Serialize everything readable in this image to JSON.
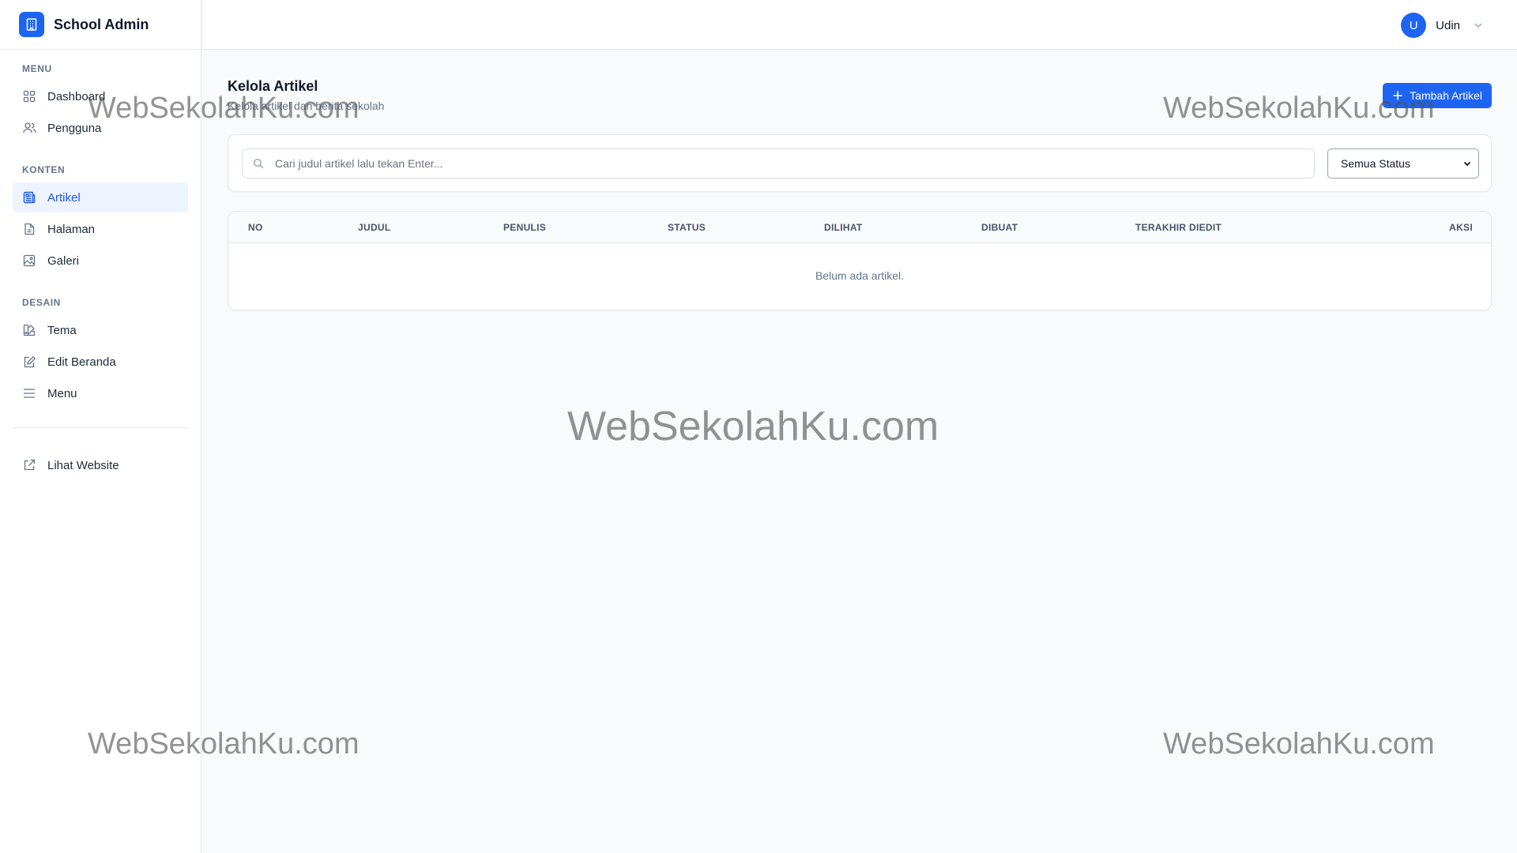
{
  "brand": {
    "name": "School Admin"
  },
  "sidebar": {
    "sections": [
      {
        "label": "MENU",
        "items": [
          {
            "label": "Dashboard",
            "icon": "grid-icon"
          },
          {
            "label": "Pengguna",
            "icon": "users-icon"
          }
        ]
      },
      {
        "label": "KONTEN",
        "items": [
          {
            "label": "Artikel",
            "icon": "newspaper-icon",
            "active": true
          },
          {
            "label": "Halaman",
            "icon": "file-icon"
          },
          {
            "label": "Galeri",
            "icon": "image-icon"
          }
        ]
      },
      {
        "label": "DESAIN",
        "items": [
          {
            "label": "Tema",
            "icon": "palette-icon"
          },
          {
            "label": "Edit Beranda",
            "icon": "edit-icon"
          },
          {
            "label": "Menu",
            "icon": "menu-icon"
          }
        ]
      }
    ],
    "external_link": {
      "label": "Lihat Website",
      "icon": "external-link-icon"
    }
  },
  "user": {
    "initial": "U",
    "name": "Udin"
  },
  "page": {
    "title": "Kelola Artikel",
    "subtitle": "Kelola artikel dan berita sekolah",
    "add_button": "Tambah Artikel"
  },
  "filters": {
    "search_placeholder": "Cari judul artikel lalu tekan Enter...",
    "search_value": "",
    "status_selected": "Semua Status"
  },
  "table": {
    "columns": [
      "NO",
      "JUDUL",
      "PENULIS",
      "STATUS",
      "DILIHAT",
      "DIBUAT",
      "TERAKHIR DIEDIT",
      "AKSI"
    ],
    "rows": [],
    "empty_message": "Belum ada artikel."
  },
  "watermark": {
    "text": "WebSekolahKu.com"
  },
  "colors": {
    "accent": "#1d64f2",
    "active_bg": "#eef4ff",
    "active_text": "#1d55e8"
  }
}
